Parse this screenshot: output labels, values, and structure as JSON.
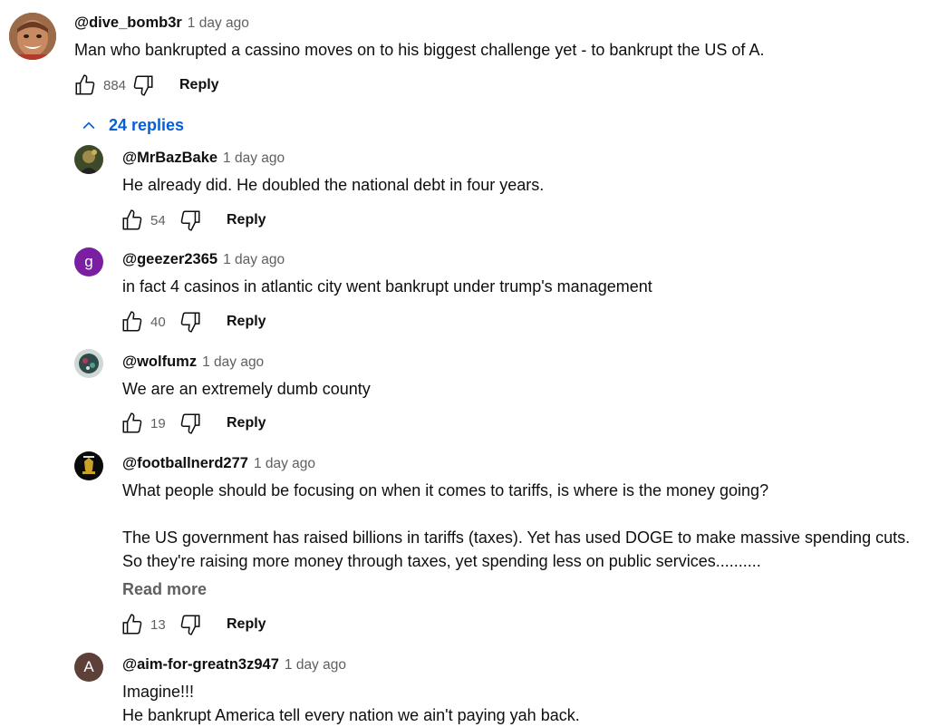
{
  "comment": {
    "author": "@dive_bomb3r",
    "time": "1 day ago",
    "text": "Man who bankrupted a cassino moves on to his biggest challenge yet - to bankrupt the US of A.",
    "likes": "884",
    "reply_label": "Reply"
  },
  "replies_toggle": "24 replies",
  "replies": [
    {
      "author": "@MrBazBake",
      "time": "1 day ago",
      "text": "He already did. He doubled the national debt in four years.",
      "likes": "54",
      "reply_label": "Reply"
    },
    {
      "author": "@geezer2365",
      "time": "1 day ago",
      "avatar_letter": "g",
      "text": "in fact 4 casinos in atlantic city went bankrupt under trump's management",
      "likes": "40",
      "reply_label": "Reply"
    },
    {
      "author": "@wolfumz",
      "time": "1 day ago",
      "text": "We are an extremely dumb county",
      "likes": "19",
      "reply_label": "Reply"
    },
    {
      "author": "@footballnerd277",
      "time": "1 day ago",
      "text_lines": [
        "What people should be focusing on when it comes to tariffs, is where is the money going?",
        "",
        "The US government has raised billions in tariffs (taxes). Yet has used DOGE to make massive spending cuts.",
        "So they're raising more money through taxes, yet spending less on public services.........."
      ],
      "read_more": "Read more",
      "likes": "13",
      "reply_label": "Reply"
    },
    {
      "author": "@aim-for-greatn3z947",
      "time": "1 day ago",
      "avatar_letter": "A",
      "text_lines": [
        "Imagine!!!",
        "He bankrupt America tell every nation we ain't paying yah back."
      ]
    }
  ],
  "colors": {
    "link_blue": "#065fd4",
    "avatar_geezer": "#7b1fa2",
    "avatar_aim": "#5d4037",
    "secondary_text": "#606060"
  },
  "icons": {
    "like": "thumb-up-outline-icon",
    "dislike": "thumb-down-outline-icon",
    "toggle": "chevron-up-icon"
  }
}
